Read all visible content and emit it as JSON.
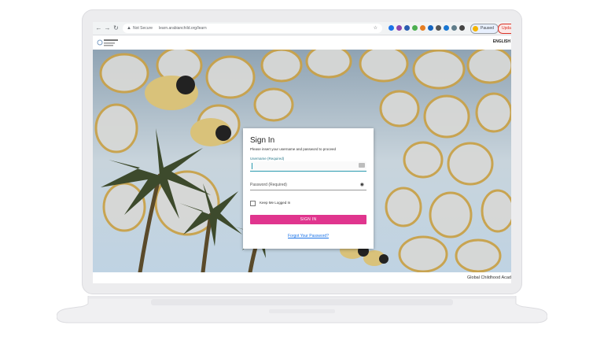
{
  "browser": {
    "security_label": "Not Secure",
    "url": "learn.arabianchild.org/learn",
    "profile_label": "Paused",
    "update_label": "Upda"
  },
  "site": {
    "language_label": "ENGLISH",
    "footer_text": "Global Childhood Acad"
  },
  "signin": {
    "title": "Sign In",
    "subtitle": "Please insert your username and password to proceed",
    "username_label": "Username  (Required)",
    "password_label": "Password (Required)",
    "keep_logged_in_label": "Keep Me Logged In",
    "signin_button_label": "SIGN IN",
    "forgot_password_label": "Forgot Your Password?"
  },
  "colors": {
    "accent": "#e0358e",
    "focus": "#2b9bb0",
    "link": "#1a73e8"
  },
  "icons": [
    "back-icon",
    "forward-icon",
    "reload-icon",
    "lock-icon",
    "eye-icon",
    "keyboard-icon",
    "checkbox-icon"
  ]
}
